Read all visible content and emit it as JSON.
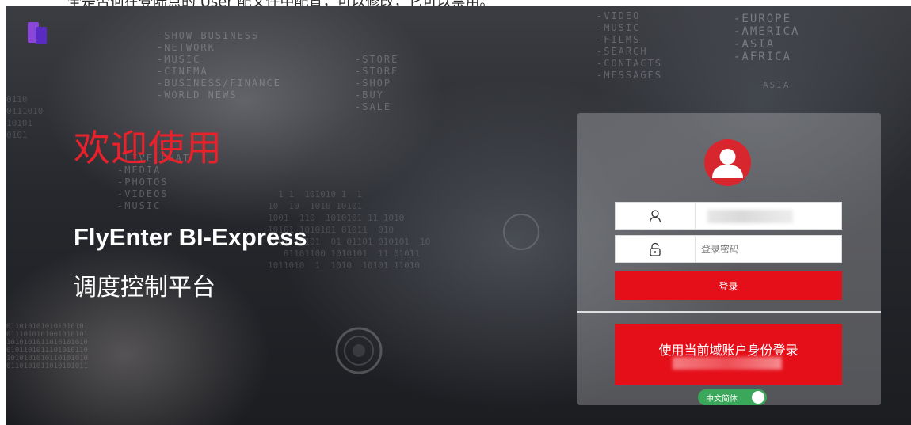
{
  "top_notice": "全是否何在登陆点的 User 配文件中配置，可以修改，它可以禁用。",
  "background": {
    "left_menu": "-SHOW BUSINESS\n-NETWORK\n-MUSIC\n-CINEMA\n-BUSINESS/FINANCE\n-WORLD NEWS",
    "center_menu": "-STORE\n-STORE\n-SHOP\n-BUY\n-SALE",
    "right_menu": "-VIDEO\n-MUSIC\n-FILMS\n-SEARCH\n-CONTACTS\n-MESSAGES",
    "lower_menu": "-LIVE CHAT\n-MEDIA\n-PHOTOS\n-VIDEOS\n-MUSIC",
    "regions": "-EUROPE\n-AMERICA\n-ASIA\n-AFRICA",
    "region_label": "ASIA"
  },
  "hero": {
    "welcome": "欢迎使用",
    "product": "FlyEnter BI-Express",
    "subtitle": "调度控制平台"
  },
  "login": {
    "password_placeholder": "登录密码",
    "login_button": "登录",
    "domain_button": "使用当前域账户身份登录",
    "language": "中文简体"
  },
  "colors": {
    "accent": "#e50f1a",
    "welcome_text": "#e8212b",
    "avatar": "#d8262f",
    "toggle": "#3aa75a"
  },
  "icons": {
    "logo": "app-logo",
    "avatar": "user-avatar-icon",
    "user_field": "user-icon",
    "password_field": "lock-icon"
  }
}
